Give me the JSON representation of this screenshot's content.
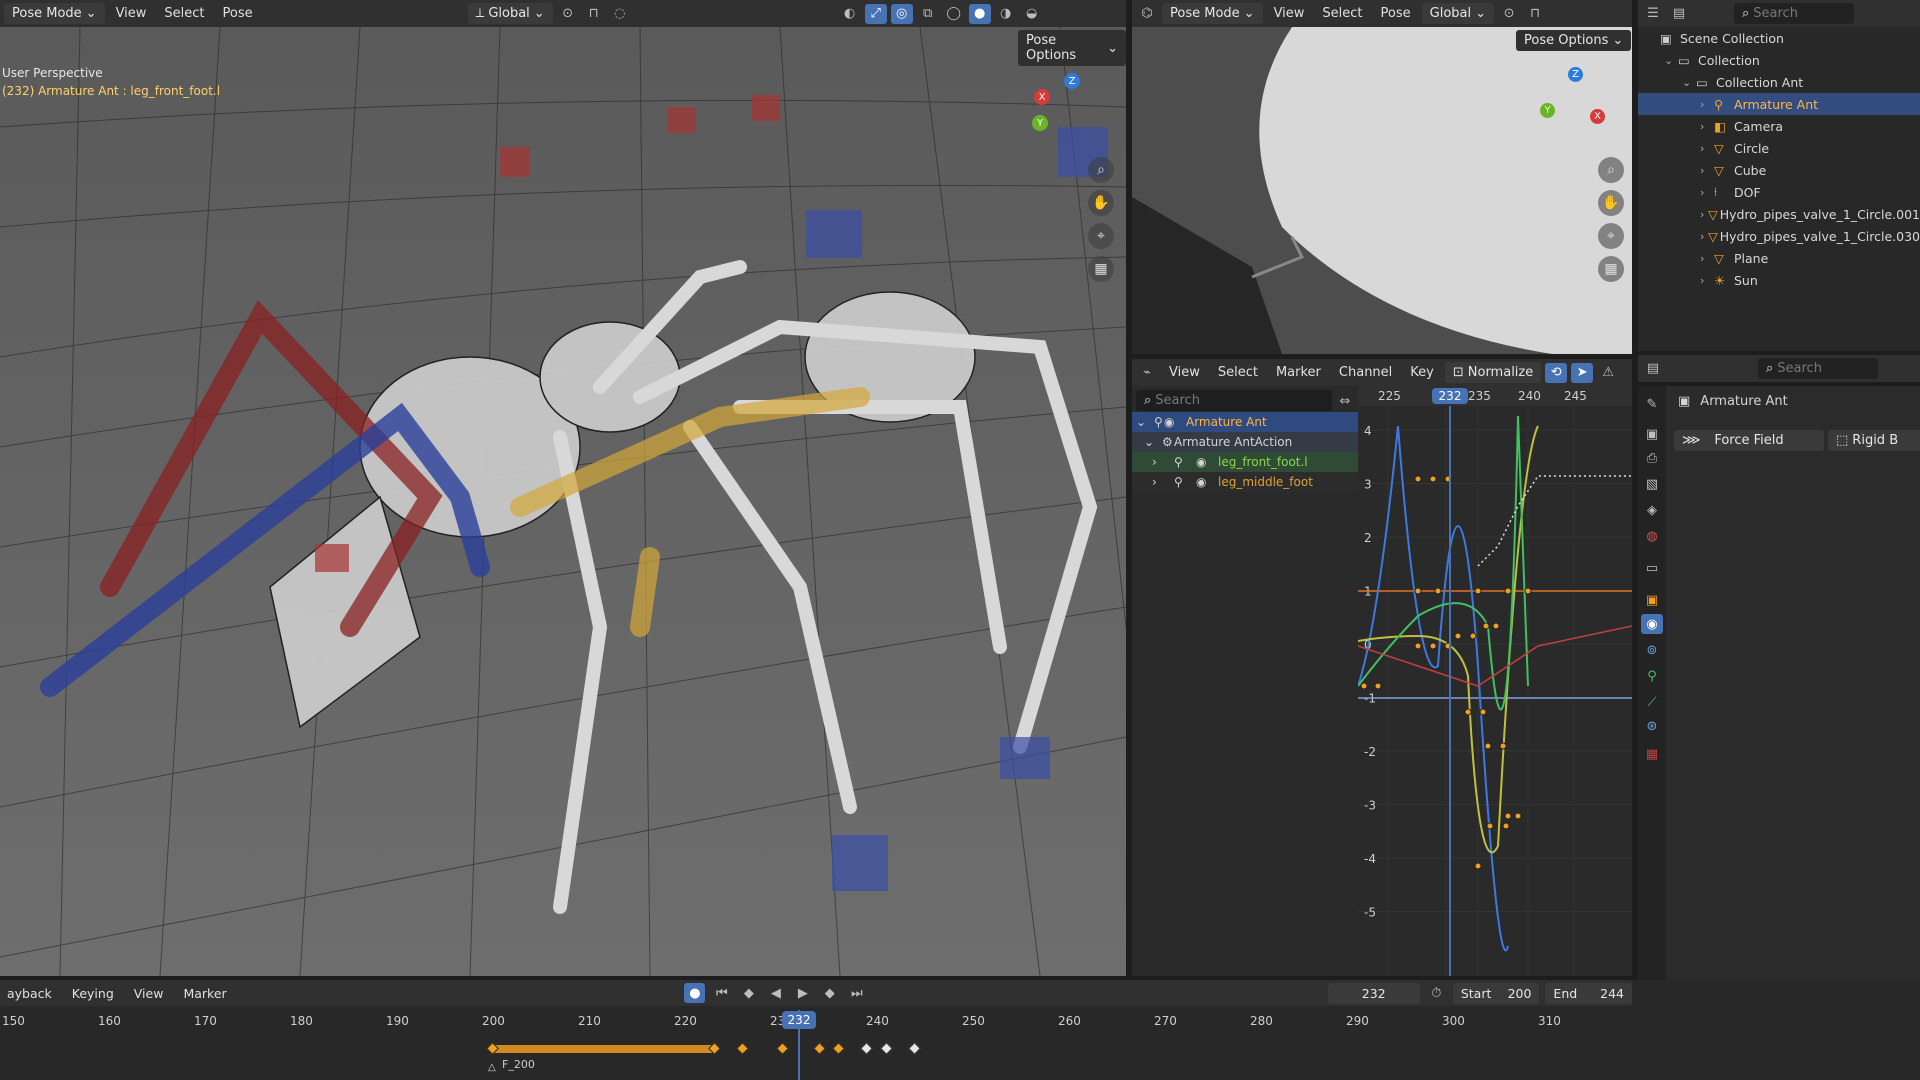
{
  "viewport1": {
    "header": {
      "mode": "Pose Mode",
      "menus": [
        "View",
        "Select",
        "Pose"
      ],
      "orientation": "Global",
      "pose_options": "Pose Options"
    },
    "overlay_title": "User Perspective",
    "overlay_subtitle": "(232) Armature Ant : leg_front_foot.l",
    "gizmo_labels": {
      "x": "X",
      "y": "Y",
      "z": "Z"
    }
  },
  "viewport2": {
    "header": {
      "mode": "Pose Mode",
      "menus": [
        "View",
        "Select",
        "Pose"
      ],
      "orientation": "Global",
      "pose_options": "Pose Options"
    },
    "gizmo_labels": {
      "x": "X",
      "y": "Y",
      "z": "Z"
    }
  },
  "outliner": {
    "search_placeholder": "Search",
    "items": [
      {
        "label": "Scene Collection",
        "depth": 0,
        "icon": "scene-collection-icon"
      },
      {
        "label": "Collection",
        "depth": 1,
        "icon": "collection-icon"
      },
      {
        "label": "Collection Ant",
        "depth": 2,
        "icon": "collection-icon"
      },
      {
        "label": "Armature Ant",
        "depth": 3,
        "icon": "armature-icon",
        "selected": true
      },
      {
        "label": "Camera",
        "depth": 3,
        "icon": "camera-icon"
      },
      {
        "label": "Circle",
        "depth": 3,
        "icon": "mesh-icon"
      },
      {
        "label": "Cube",
        "depth": 3,
        "icon": "mesh-icon"
      },
      {
        "label": "DOF",
        "depth": 3,
        "icon": "empty-icon"
      },
      {
        "label": "Hydro_pipes_valve_1_Circle.001",
        "depth": 3,
        "icon": "mesh-icon"
      },
      {
        "label": "Hydro_pipes_valve_1_Circle.030",
        "depth": 3,
        "icon": "mesh-icon"
      },
      {
        "label": "Plane",
        "depth": 3,
        "icon": "mesh-icon"
      },
      {
        "label": "Sun",
        "depth": 3,
        "icon": "light-icon"
      }
    ]
  },
  "properties": {
    "search_placeholder": "Search",
    "object_name": "Armature Ant",
    "buttons": [
      "Force Field",
      "Rigid B"
    ]
  },
  "graph_editor": {
    "menus": [
      "View",
      "Select",
      "Marker",
      "Channel",
      "Key"
    ],
    "normalize": "Normalize",
    "search_placeholder": "Search",
    "frame_labels": [
      "225",
      "23",
      "235",
      "240",
      "245"
    ],
    "current_frame": "232",
    "value_labels": [
      "4",
      "3",
      "2",
      "1",
      "0",
      "-1",
      "-2",
      "-3",
      "-4",
      "-5"
    ],
    "channels": [
      {
        "label": "Armature Ant",
        "color": "#ffb545"
      },
      {
        "label": "Armature AntAction",
        "color": "#d0d0d0"
      },
      {
        "label": "leg_front_foot.l",
        "color": "#8ad84a"
      },
      {
        "label": "leg_middle_foot",
        "color": "#e0a030"
      }
    ]
  },
  "timeline": {
    "menus": [
      "ayback",
      "Keying",
      "View",
      "Marker"
    ],
    "current_frame": "232",
    "start_label": "Start",
    "start": "200",
    "end_label": "End",
    "end": "244",
    "frame_labels": [
      "150",
      "160",
      "170",
      "180",
      "190",
      "200",
      "210",
      "220",
      "23",
      "240",
      "250",
      "260",
      "270",
      "280",
      "290",
      "300",
      "310"
    ],
    "marker": "F_200"
  },
  "colors": {
    "accent": "#4772b3",
    "selected_text": "#ffb545",
    "keyframe": "#f0a020",
    "playhead": "#4772b3"
  }
}
